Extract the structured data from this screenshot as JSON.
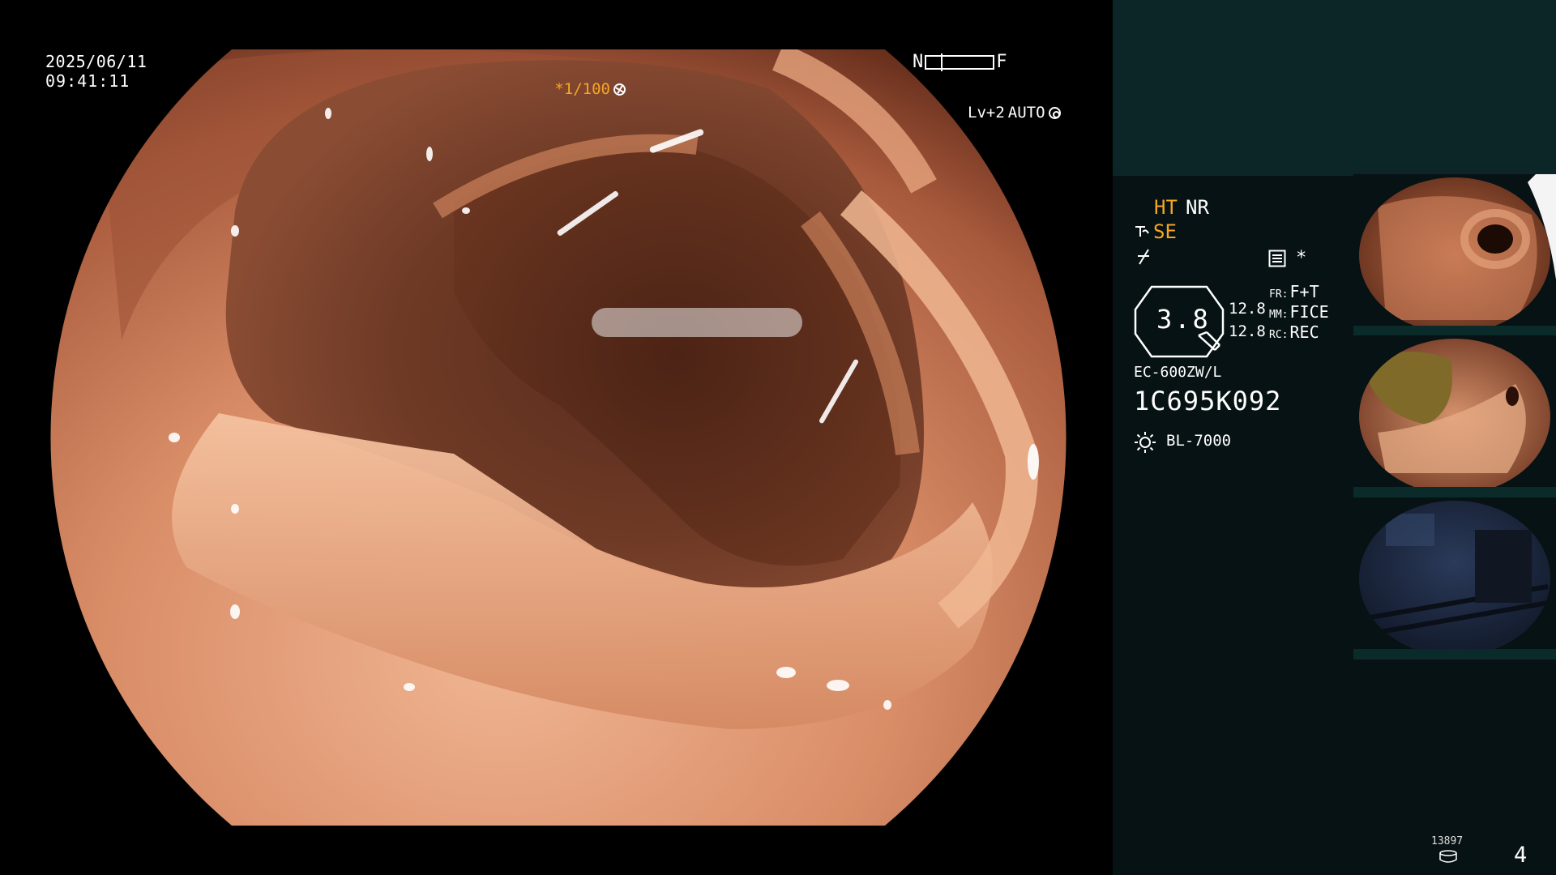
{
  "overlay": {
    "date": "2025/06/11",
    "time": "09:41:11",
    "focus_near": "N",
    "focus_far": "F",
    "shutter": "*1/100",
    "level": "Lv+2",
    "iris_mode": "AUTO"
  },
  "panel": {
    "ht": "HT",
    "nr": "NR",
    "se": "SE",
    "star": "*",
    "zoom": "3.8",
    "value_1": "12.8",
    "value_2": "12.8",
    "fr_key": "FR:",
    "fr_val": "F+T",
    "mm_key": "MM:",
    "mm_val": "FICE",
    "rc_key": "RC:",
    "rc_val": "REC",
    "scope_model": "EC-600ZW/L",
    "scope_serial": "1C695K092",
    "light_source": "BL-7000"
  },
  "footer": {
    "image_count": "13897",
    "page_number": "4"
  },
  "colors": {
    "accent_orange": "#f5a623",
    "panel_bg": "#071214",
    "panel_top": "#0c2628"
  },
  "icons": {
    "aperture": "aperture-icon",
    "auto_iris": "auto-iris-icon",
    "structure_enhance": "structure-enhance-icon",
    "slash": "slash-mode-icon",
    "menu": "menu-list-icon",
    "light": "sun-icon",
    "storage": "disk-icon"
  }
}
